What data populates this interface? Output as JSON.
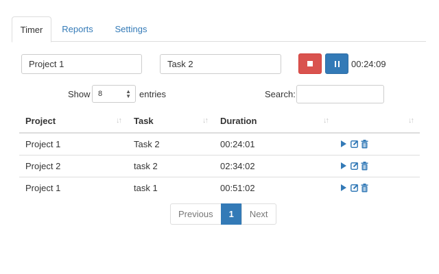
{
  "tabs": [
    "Timer",
    "Reports",
    "Settings"
  ],
  "timer": {
    "project_value": "Project 1",
    "task_value": "Task 2",
    "elapsed": "00:24:09"
  },
  "length": {
    "label_show": "Show",
    "selected": "8",
    "label_entries": "entries"
  },
  "search": {
    "label": "Search:",
    "value": ""
  },
  "table": {
    "headers": [
      "Project",
      "Task",
      "Duration",
      ""
    ],
    "rows": [
      {
        "project": "Project 1",
        "task": "Task 2",
        "duration": "00:24:01"
      },
      {
        "project": "Project 2",
        "task": "task 2",
        "duration": "02:34:02"
      },
      {
        "project": "Project 1",
        "task": "task 1",
        "duration": "00:51:02"
      }
    ]
  },
  "pagination": {
    "previous": "Previous",
    "current": "1",
    "next": "Next"
  },
  "colors": {
    "primary": "#337ab7",
    "danger": "#d9534f",
    "border": "#dddddd"
  },
  "icons": [
    "stop-icon",
    "pause-icon",
    "sort-icon",
    "play-icon",
    "edit-icon",
    "trash-icon"
  ]
}
